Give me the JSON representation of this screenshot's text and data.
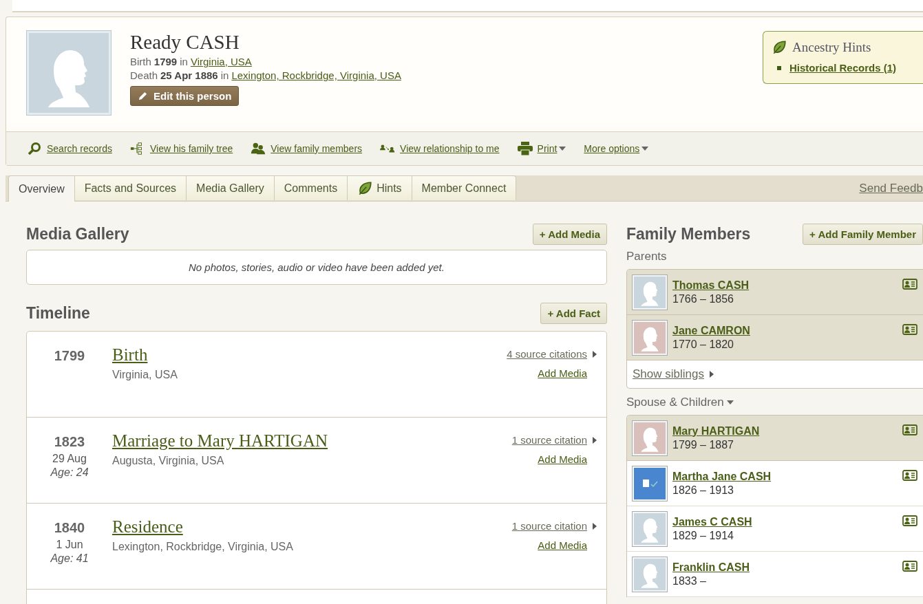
{
  "person": {
    "name": "Ready CASH",
    "photo": {
      "kind": "male"
    },
    "birth": {
      "label": "Birth",
      "date": "1799",
      "in": "in",
      "place": "Virginia, USA"
    },
    "death": {
      "label": "Death",
      "date": "25 Apr 1886",
      "in": "in",
      "place": "Lexington, Rockbridge, Virginia, USA"
    },
    "edit_button": "Edit this person"
  },
  "hints": {
    "title": "Ancestry Hints",
    "items": [
      "Historical Records (1)"
    ]
  },
  "actions": [
    {
      "kind": "search",
      "label": "Search records",
      "dropdown": false
    },
    {
      "kind": "tree",
      "label": "View his family tree",
      "dropdown": false
    },
    {
      "kind": "members",
      "label": "View family members",
      "dropdown": false
    },
    {
      "kind": "relationship",
      "label": "View relationship to me",
      "dropdown": false
    },
    {
      "kind": "print",
      "label": "Print",
      "dropdown": true
    },
    {
      "kind": "none",
      "label": "More options",
      "dropdown": true
    }
  ],
  "tabs": [
    {
      "label": "Overview",
      "selected": true,
      "icon": false
    },
    {
      "label": "Facts and Sources",
      "selected": false,
      "icon": false
    },
    {
      "label": "Media Gallery",
      "selected": false,
      "icon": false
    },
    {
      "label": "Comments",
      "selected": false,
      "icon": false
    },
    {
      "label": "Hints",
      "selected": false,
      "icon": true
    },
    {
      "label": "Member Connect",
      "selected": false,
      "icon": false
    }
  ],
  "feedback_link": "Send Feedb",
  "media_gallery": {
    "title": "Media Gallery",
    "button": "+ Add Media",
    "empty": "No photos, stories, audio or video have been added yet."
  },
  "timeline": {
    "title": "Timeline",
    "button": "+ Add Fact",
    "events": [
      {
        "year": "1799",
        "title": "Birth",
        "place": "Virginia, USA",
        "citations": "4 source citations",
        "add_media": "Add Media"
      },
      {
        "year": "1823",
        "date": "29 Aug",
        "age": "Age: 24",
        "title": "Marriage to Mary HARTIGAN",
        "place": "Augusta, Virginia, USA",
        "citations": "1 source citation",
        "add_media": "Add Media"
      },
      {
        "year": "1840",
        "date": "1 Jun",
        "age": "Age: 41",
        "title": "Residence",
        "place": "Lexington, Rockbridge, Virginia, USA",
        "citations": "1 source citation",
        "add_media": "Add Media"
      }
    ]
  },
  "family": {
    "title": "Family Members",
    "button": "+ Add Family Member",
    "parents_label": "Parents",
    "parents": [
      {
        "name": "Thomas CASH",
        "years": "1766 – 1856",
        "kind": "male",
        "highlighted": true
      },
      {
        "name": "Jane CAMRON",
        "years": "1770 – 1820",
        "kind": "female",
        "highlighted": true
      }
    ],
    "siblings_link": "Show siblings",
    "spouse_label": "Spouse & Children",
    "spouse_children": [
      {
        "name": "Mary HARTIGAN",
        "years": "1799 – 1887",
        "kind": "female",
        "highlighted": true
      },
      {
        "name": "Martha Jane CASH",
        "years": "1826 – 1913",
        "kind": "record",
        "highlighted": false
      },
      {
        "name": "James C CASH",
        "years": "1829 – 1914",
        "kind": "male",
        "highlighted": false
      },
      {
        "name": "Franklin CASH",
        "years": "1833 –",
        "kind": "male",
        "highlighted": false
      }
    ]
  }
}
